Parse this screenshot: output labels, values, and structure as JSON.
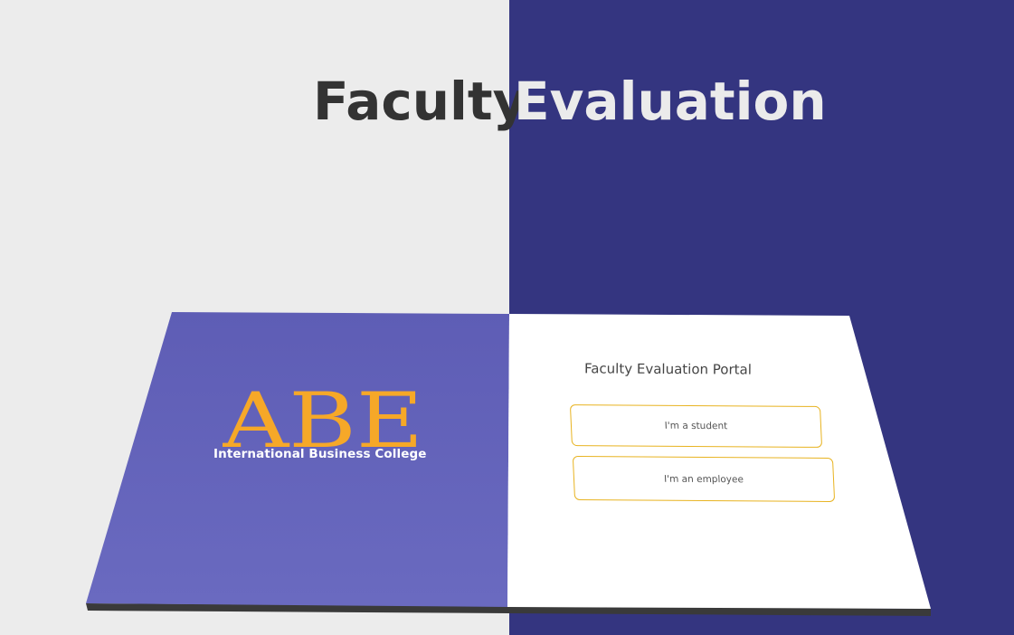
{
  "page": {
    "title_word1": "Faculty",
    "title_word2": "Evaluation"
  },
  "card": {
    "logo_letters": "ABE",
    "logo_subtitle": "International Business College",
    "portal_title": "Faculty Evaluation Portal",
    "student_button_label": "I'm a student",
    "employee_button_label": "I'm an employee"
  },
  "colors": {
    "background_left": "#ececec",
    "background_right": "#343580",
    "card_left_panel": "#6060b8",
    "card_right_panel": "#ffffff",
    "logo_accent": "#f6a828",
    "button_border": "#e8b320"
  }
}
